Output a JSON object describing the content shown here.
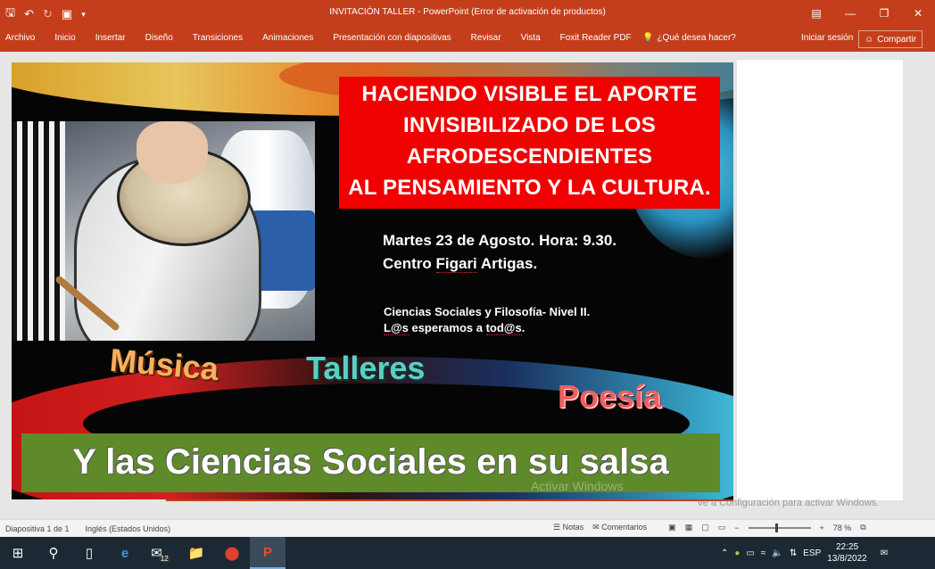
{
  "window": {
    "title": "INVITACIÓN TALLER - PowerPoint (Error de activación de productos)"
  },
  "ribbon": {
    "tabs": [
      "Archivo",
      "Inicio",
      "Insertar",
      "Diseño",
      "Transiciones",
      "Animaciones",
      "Presentación con diapositivas",
      "Revisar",
      "Vista",
      "Foxit Reader PDF"
    ],
    "tell_me": "¿Qué desea hacer?",
    "sign_in": "Iniciar sesión",
    "share": "Compartir"
  },
  "slide": {
    "headline": [
      "HACIENDO VISIBLE EL APORTE",
      "INVISIBILIZADO DE LOS",
      "AFRODESCENDIENTES",
      "AL PENSAMIENTO Y LA CULTURA."
    ],
    "event_line1": "Martes 23 de Agosto. Hora: 9.30.",
    "event_line2_pre": "Centro ",
    "event_line2_figari": "Figari",
    "event_line2_post": " Artigas.",
    "course": "Ciencias Sociales y Filosofía- Nivel II.",
    "invite_pre": "L@s",
    "invite_mid": " esperamos a ",
    "invite_end": "tod@s",
    "invite_dot": ".",
    "word1": "Música",
    "word2": "Talleres",
    "word3": "Poesía",
    "banner": "Y las Ciencias Sociales en su salsa"
  },
  "watermark": {
    "line1": "Activar Windows",
    "line2": "Ve a Configuración para activar Windows."
  },
  "statusbar": {
    "slide_counter": "Diapositiva 1 de 1",
    "language": "Inglés (Estados Unidos)",
    "notes": "Notas",
    "comments": "Comentarios",
    "zoom": "78 %"
  },
  "taskbar": {
    "mail_badge": "12",
    "lang": "ESP",
    "time": "22:25",
    "date": "13/8/2022"
  }
}
